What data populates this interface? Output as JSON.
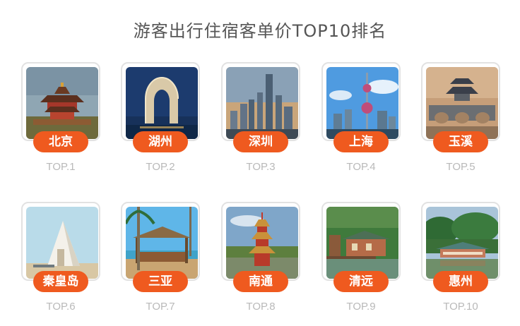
{
  "title": "游客出行住宿客单价TOP10排名",
  "accent_color": "#ef5a1f",
  "cities": [
    {
      "name": "北京",
      "rank": "TOP.1",
      "photo": "forbidden-city-watchtower-image"
    },
    {
      "name": "湖州",
      "rank": "TOP.2",
      "photo": "horseshoe-hotel-image"
    },
    {
      "name": "深圳",
      "rank": "TOP.3",
      "photo": "skyline-image"
    },
    {
      "name": "上海",
      "rank": "TOP.4",
      "photo": "oriental-pearl-tower-image"
    },
    {
      "name": "玉溪",
      "rank": "TOP.5",
      "photo": "pavilion-bridge-image"
    },
    {
      "name": "秦皇岛",
      "rank": "TOP.6",
      "photo": "beach-chapel-image"
    },
    {
      "name": "三亚",
      "rank": "TOP.7",
      "photo": "beach-pavilion-palm-image"
    },
    {
      "name": "南通",
      "rank": "TOP.8",
      "photo": "pagoda-image"
    },
    {
      "name": "清远",
      "rank": "TOP.9",
      "photo": "lakeside-house-image"
    },
    {
      "name": "惠州",
      "rank": "TOP.10",
      "photo": "lake-pavilion-image"
    }
  ]
}
